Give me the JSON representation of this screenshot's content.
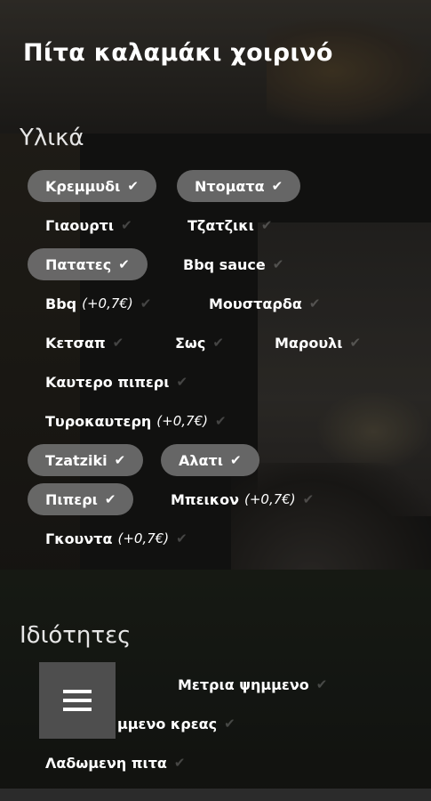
{
  "title": "Πίτα καλαμάκι χοιρινό",
  "ingredients_heading": "Υλικά",
  "ingredients": [
    {
      "label": "Κρεμμυδι",
      "extra": "",
      "selected": true
    },
    {
      "label": "Ντοματα",
      "extra": "",
      "selected": true
    },
    {
      "label": "Γιαουρτι",
      "extra": "",
      "selected": false
    },
    {
      "label": "Τζατζικι",
      "extra": "",
      "selected": false
    },
    {
      "label": "Πατατες",
      "extra": "",
      "selected": true
    },
    {
      "label": "Bbq sauce",
      "extra": "",
      "selected": false
    },
    {
      "label": "Bbq",
      "extra": "(+0,7€)",
      "selected": false
    },
    {
      "label": "Μουσταρδα",
      "extra": "",
      "selected": false
    },
    {
      "label": "Κετσαπ",
      "extra": "",
      "selected": false
    },
    {
      "label": "Σως",
      "extra": "",
      "selected": false
    },
    {
      "label": "Μαρουλι",
      "extra": "",
      "selected": false
    },
    {
      "label": "Καυτερο πιπερι",
      "extra": "",
      "selected": false
    },
    {
      "label": "Τυροκαυτερη",
      "extra": "(+0,7€)",
      "selected": false
    },
    {
      "label": "Tzatziki",
      "extra": "",
      "selected": true
    },
    {
      "label": "Αλατι",
      "extra": "",
      "selected": true
    },
    {
      "label": "Πιπερι",
      "extra": "",
      "selected": true
    },
    {
      "label": "Μπεικον",
      "extra": "(+0,7€)",
      "selected": false
    },
    {
      "label": "Γκουντα",
      "extra": "(+0,7€)",
      "selected": false
    }
  ],
  "properties_heading": "Ιδιότητες",
  "properties": [
    {
      "label": "Μετρια ψημμενο",
      "extra": "",
      "selected": false
    },
    {
      "label": "μμενο κρεας",
      "extra": "",
      "selected": false
    },
    {
      "label": "Λαδωμενη πιτα",
      "extra": "",
      "selected": false
    }
  ],
  "check_glyph": "✔",
  "menu_icon": "hamburger-icon",
  "colors": {
    "selected_pill": "#767676",
    "menu_button": "#4e4e4e"
  }
}
